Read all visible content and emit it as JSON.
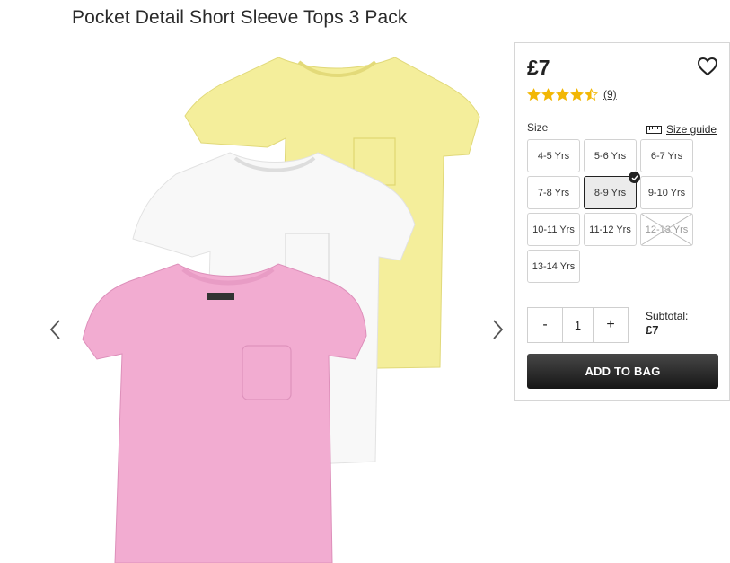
{
  "product": {
    "title": "Pocket Detail Short Sleeve Tops 3 Pack",
    "price": "£7",
    "rating": 4.5,
    "review_count": "(9)"
  },
  "gallery": {
    "shirt_colors": [
      "#f4ee9b",
      "#f8f8f8",
      "#f2acd1"
    ],
    "prev_icon": "chevron-left-icon",
    "next_icon": "chevron-right-icon"
  },
  "size": {
    "label": "Size",
    "guide_label": "Size guide",
    "options": [
      {
        "label": "4-5 Yrs",
        "state": "available"
      },
      {
        "label": "5-6 Yrs",
        "state": "available"
      },
      {
        "label": "6-7 Yrs",
        "state": "available"
      },
      {
        "label": "7-8 Yrs",
        "state": "available"
      },
      {
        "label": "8-9 Yrs",
        "state": "selected"
      },
      {
        "label": "9-10 Yrs",
        "state": "available"
      },
      {
        "label": "10-11 Yrs",
        "state": "available"
      },
      {
        "label": "11-12 Yrs",
        "state": "available"
      },
      {
        "label": "12-13 Yrs",
        "state": "unavailable"
      },
      {
        "label": "13-14 Yrs",
        "state": "available"
      }
    ]
  },
  "quantity": {
    "minus": "-",
    "value": "1",
    "plus": "+"
  },
  "subtotal": {
    "label": "Subtotal:",
    "value": "£7"
  },
  "cart": {
    "add_label": "ADD TO BAG"
  },
  "colors": {
    "star": "#f2b705",
    "button_dark": "#222222"
  }
}
